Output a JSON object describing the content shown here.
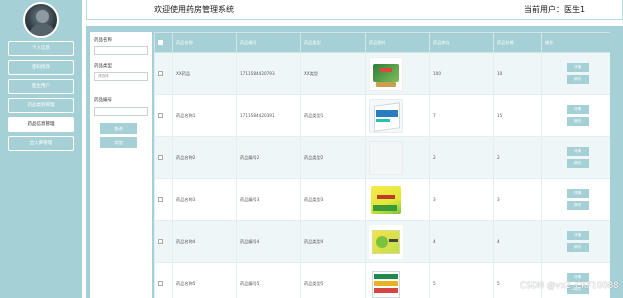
{
  "sidebar": {
    "items": [
      {
        "label": "个人信息"
      },
      {
        "label": "密码修改"
      },
      {
        "label": "医生用户"
      },
      {
        "label": "药品类别管理"
      },
      {
        "label": "药品信息管理"
      },
      {
        "label": "出入库管理"
      }
    ],
    "active_index": 4
  },
  "header": {
    "title": "欢迎使用药房管理系统",
    "user": "当前用户：医生1"
  },
  "filter": {
    "name_label": "药品名称",
    "type_label": "药品类型",
    "type_placeholder": "请选择",
    "code_label": "药品编号",
    "search_label": "查询",
    "add_label": "添加"
  },
  "table": {
    "headers": [
      "",
      "药品名称",
      "药品编号",
      "药品类型",
      "药品图片",
      "药品库存",
      "药品价格",
      "操作"
    ],
    "rows": [
      {
        "name": "XX药品",
        "code": "1711584420793",
        "type": "XX类型",
        "stock": "100",
        "price": "10",
        "image": "herbal-tea-box"
      },
      {
        "name": "药品名称1",
        "code": "1711584420391",
        "type": "药品类型1",
        "stock": "7",
        "price": "15",
        "image": "blue-medicine-box"
      },
      {
        "name": "药品名称2",
        "code": "药品编号2",
        "type": "药品类型2",
        "stock": "2",
        "price": "2",
        "image": ""
      },
      {
        "name": "药品名称3",
        "code": "药品编号3",
        "type": "药品类型3",
        "stock": "3",
        "price": "3",
        "image": "yellow-medicine-box"
      },
      {
        "name": "药品名称4",
        "code": "药品编号4",
        "type": "药品类型4",
        "stock": "4",
        "price": "4",
        "image": "yellow-green-box"
      },
      {
        "name": "药品名称5",
        "code": "药品编号5",
        "type": "药品类型5",
        "stock": "5",
        "price": "5",
        "image": "colorful-medicine-box"
      }
    ],
    "detail_label": "详情",
    "edit_label": "修改"
  },
  "watermark": "CSDN @vx2_CKF10088"
}
